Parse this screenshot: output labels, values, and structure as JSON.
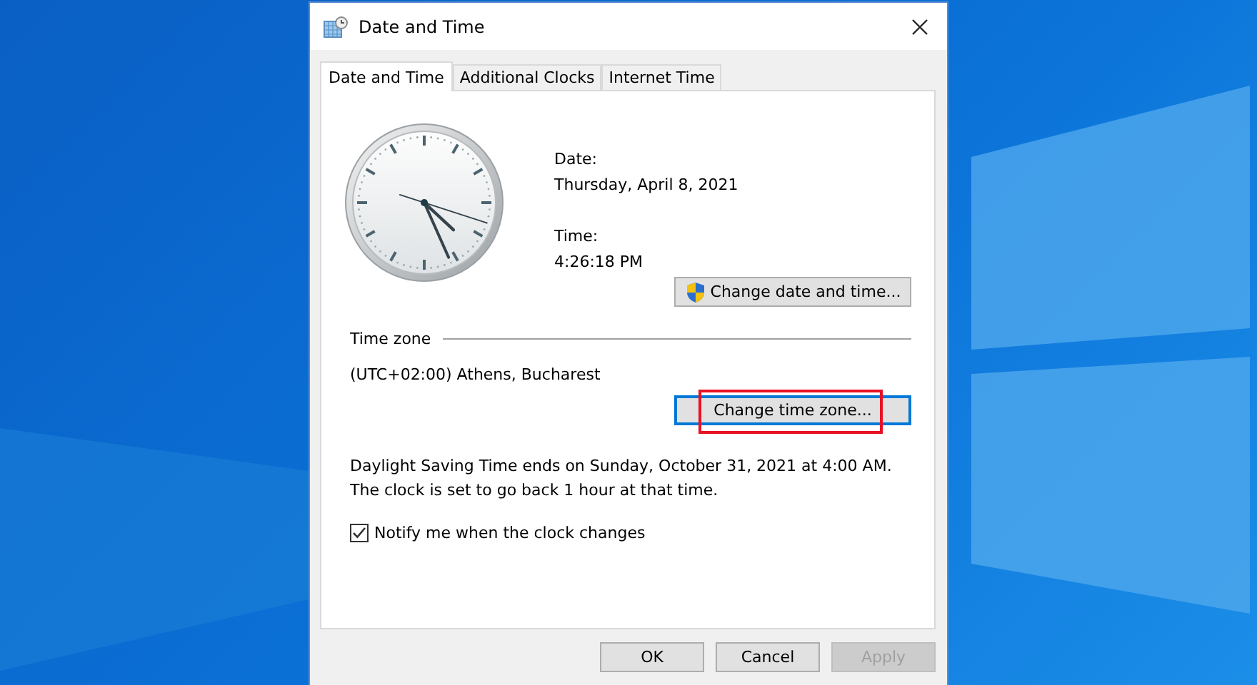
{
  "window": {
    "title": "Date and Time"
  },
  "tabs": [
    {
      "label": "Date and Time",
      "selected": true
    },
    {
      "label": "Additional Clocks",
      "selected": false
    },
    {
      "label": "Internet Time",
      "selected": false
    }
  ],
  "date": {
    "label": "Date:",
    "value": "Thursday, April 8, 2021"
  },
  "time": {
    "label": "Time:",
    "value": "4:26:18 PM"
  },
  "change_date_button": {
    "label": "Change date and time..."
  },
  "time_zone": {
    "heading": "Time zone",
    "value": "(UTC+02:00) Athens, Bucharest",
    "button": {
      "label": "Change time zone...",
      "focused": true,
      "highlighted": true
    }
  },
  "dst_note": "Daylight Saving Time ends on Sunday, October 31, 2021 at 4:00 AM. The clock is set to go back 1 hour at that time.",
  "notify": {
    "label": "Notify me when the clock changes",
    "checked": true
  },
  "buttons": [
    {
      "label": "OK",
      "disabled": false
    },
    {
      "label": "Cancel",
      "disabled": false
    },
    {
      "label": "Apply",
      "disabled": true
    }
  ]
}
